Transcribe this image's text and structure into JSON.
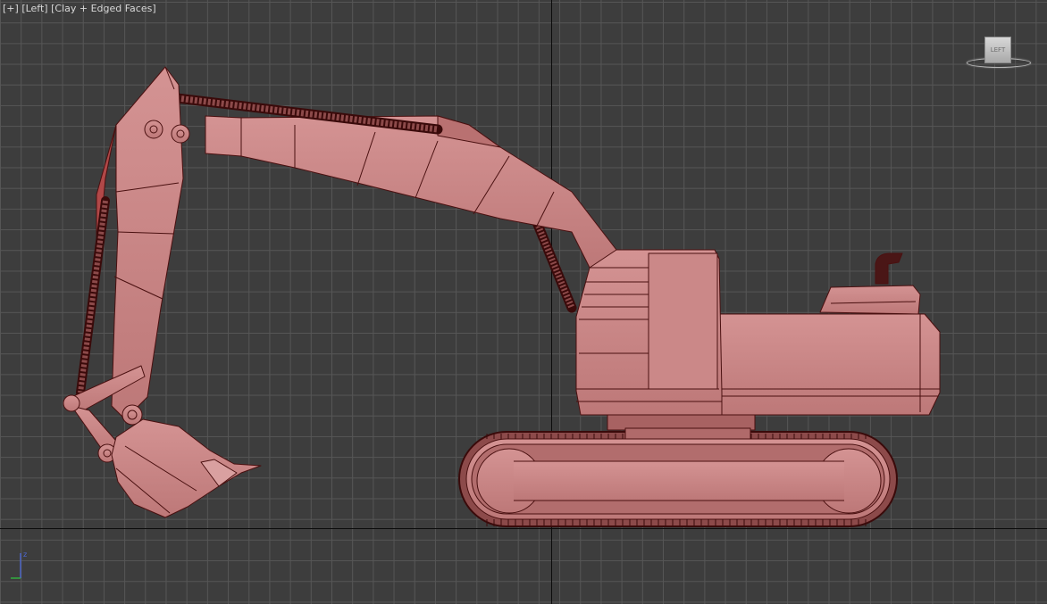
{
  "viewport": {
    "menu_plus": "[+]",
    "view_name": "[Left]",
    "shading_mode": "[Clay + Edged Faces]"
  },
  "viewcube": {
    "face_label": "LEFT"
  },
  "axis_gizmo": {
    "up_axis": "z"
  },
  "colors": {
    "background": "#3d3d3d",
    "grid": "#565656",
    "model_fill": "#c98585",
    "model_edge": "#4a1010",
    "label_text": "#d8d8d8"
  }
}
